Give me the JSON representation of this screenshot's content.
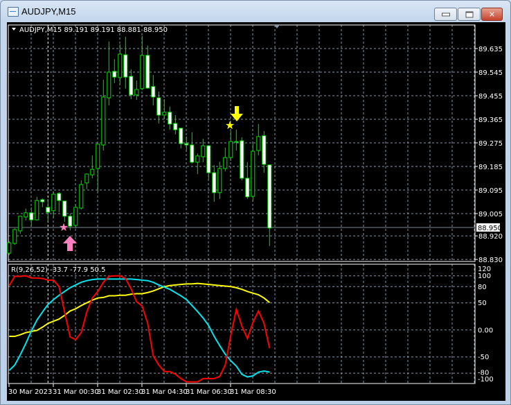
{
  "window": {
    "title": "AUDJPY,M15"
  },
  "chart": {
    "header": "AUDJPY,M15  89.191 89.191 88.881 88.950",
    "price_axis": [
      "89.635",
      "89.545",
      "89.455",
      "89.365",
      "89.275",
      "89.185",
      "89.095",
      "89.005",
      "88.920",
      "88.830"
    ],
    "bid_label": "88.950",
    "bid": 88.95,
    "time_axis": [
      "30 Mar 2023",
      "31 Mar 00:30",
      "31 Mar 02:30",
      "31 Mar 04:30",
      "31 Mar 06:30",
      "31 Mar 08:30"
    ],
    "colors": {
      "background": "#000000",
      "grid": "#8a96a4",
      "bull": "#00e000",
      "bear_body": "#ffffff",
      "bid_line": "#778899",
      "buy_signal": "#ff7fbf",
      "sell_signal": "#ffff00"
    }
  },
  "indicator": {
    "header": "R(9,26,52) -33.7 -77.9 50.5",
    "axis": [
      "120",
      "100",
      "80",
      "50",
      "0.00",
      "-50",
      "-80",
      "-100"
    ],
    "colors": {
      "fast": "#ff0000",
      "mid": "#00e5ee",
      "slow": "#ffff00"
    }
  },
  "chart_data": [
    {
      "type": "candlestick",
      "title": "AUDJPY,M15",
      "ylim": [
        88.83,
        89.72
      ],
      "ohlc": [
        [
          88.854,
          88.899,
          88.846,
          88.894
        ],
        [
          88.891,
          88.949,
          88.886,
          88.944
        ],
        [
          88.939,
          88.997,
          88.928,
          88.995
        ],
        [
          88.992,
          89.024,
          88.979,
          89.008
        ],
        [
          89.008,
          89.029,
          88.957,
          88.981
        ],
        [
          88.981,
          89.069,
          88.979,
          89.055
        ],
        [
          89.058,
          89.063,
          89.029,
          89.05
        ],
        [
          89.029,
          89.061,
          88.973,
          89.01
        ],
        [
          89.016,
          89.09,
          88.989,
          89.079
        ],
        [
          89.082,
          89.087,
          89.01,
          89.055
        ],
        [
          89.053,
          89.053,
          88.973,
          88.995
        ],
        [
          88.995,
          89.005,
          88.941,
          88.957
        ],
        [
          88.96,
          89.04,
          88.949,
          89.029
        ],
        [
          89.026,
          89.132,
          89.021,
          89.116
        ],
        [
          89.122,
          89.158,
          89.098,
          89.156
        ],
        [
          89.153,
          89.227,
          89.14,
          89.174
        ],
        [
          89.177,
          89.272,
          89.087,
          89.27
        ],
        [
          89.267,
          89.516,
          89.246,
          89.45
        ],
        [
          89.447,
          89.662,
          89.418,
          89.545
        ],
        [
          89.548,
          89.595,
          89.503,
          89.526
        ],
        [
          89.524,
          89.651,
          89.497,
          89.614
        ],
        [
          89.611,
          89.68,
          89.482,
          89.526
        ],
        [
          89.529,
          89.556,
          89.442,
          89.458
        ],
        [
          89.458,
          89.513,
          89.439,
          89.479
        ],
        [
          89.482,
          89.683,
          89.476,
          89.609
        ],
        [
          89.609,
          89.646,
          89.482,
          89.484
        ],
        [
          89.49,
          89.534,
          89.418,
          89.45
        ],
        [
          89.447,
          89.471,
          89.349,
          89.381
        ],
        [
          89.381,
          89.442,
          89.365,
          89.392
        ],
        [
          89.392,
          89.413,
          89.325,
          89.347
        ],
        [
          89.349,
          89.381,
          89.307,
          89.325
        ],
        [
          89.331,
          89.331,
          89.254,
          89.272
        ],
        [
          89.272,
          89.299,
          89.246,
          89.267
        ],
        [
          89.267,
          89.315,
          89.196,
          89.201
        ],
        [
          89.201,
          89.235,
          89.156,
          89.225
        ],
        [
          89.222,
          89.291,
          89.201,
          89.264
        ],
        [
          89.264,
          89.267,
          89.135,
          89.161
        ],
        [
          89.161,
          89.19,
          89.05,
          89.085
        ],
        [
          89.085,
          89.203,
          89.061,
          89.177
        ],
        [
          89.177,
          89.257,
          89.166,
          89.219
        ],
        [
          89.219,
          89.32,
          89.206,
          89.28
        ],
        [
          89.28,
          89.325,
          89.246,
          89.278
        ],
        [
          89.283,
          89.296,
          89.132,
          89.14
        ],
        [
          89.14,
          89.201,
          89.061,
          89.069
        ],
        [
          89.071,
          89.272,
          89.053,
          89.243
        ],
        [
          89.246,
          89.347,
          89.227,
          89.299
        ],
        [
          89.302,
          89.32,
          89.161,
          89.193
        ],
        [
          89.191,
          89.191,
          88.881,
          88.95
        ]
      ],
      "signals": [
        {
          "type": "buy",
          "candle_index": 11,
          "marker": "star-and-up-arrow"
        },
        {
          "type": "sell",
          "candle_index": 40,
          "marker": "star-and-down-arrow"
        }
      ]
    },
    {
      "type": "line",
      "title": "R(9,26,52)",
      "ylim": [
        -100,
        120
      ],
      "series": [
        {
          "name": "fast",
          "values": [
            82,
            99,
            99,
            100,
            96,
            96,
            95,
            92,
            92,
            80,
            33,
            -13,
            -18,
            -5,
            33,
            59,
            71,
            88,
            99,
            100,
            100,
            95,
            76,
            52,
            44,
            12,
            -48,
            -65,
            -77,
            -77,
            -82,
            -90,
            -96,
            -96,
            -96,
            -90,
            -90,
            -90,
            -86,
            -65,
            -10,
            38,
            7,
            -16,
            14,
            35,
            12,
            -33.7
          ]
        },
        {
          "name": "mid",
          "values": [
            -75,
            -65,
            -46,
            -25,
            -2,
            18,
            33,
            47,
            56,
            64,
            71,
            78,
            83,
            88,
            91,
            93,
            94,
            94,
            94,
            94,
            94,
            94,
            94,
            93,
            92,
            91,
            88,
            83,
            79,
            75,
            69,
            63,
            56,
            45,
            34,
            22,
            8,
            -12,
            -29,
            -45,
            -57,
            -67,
            -82,
            -87,
            -85,
            -78,
            -76,
            -77.9
          ]
        },
        {
          "name": "slow",
          "values": [
            -12,
            -12,
            -9,
            -5,
            -3,
            -1,
            5,
            12,
            16,
            20,
            27,
            35,
            39,
            45,
            50,
            55,
            59,
            60,
            63,
            63,
            64,
            64,
            66,
            67,
            67,
            69,
            72,
            76,
            80,
            82,
            83,
            84,
            85,
            85,
            86,
            85,
            84,
            83,
            82,
            81,
            80,
            78,
            75,
            71,
            68,
            65,
            59,
            50.5
          ]
        }
      ]
    }
  ]
}
